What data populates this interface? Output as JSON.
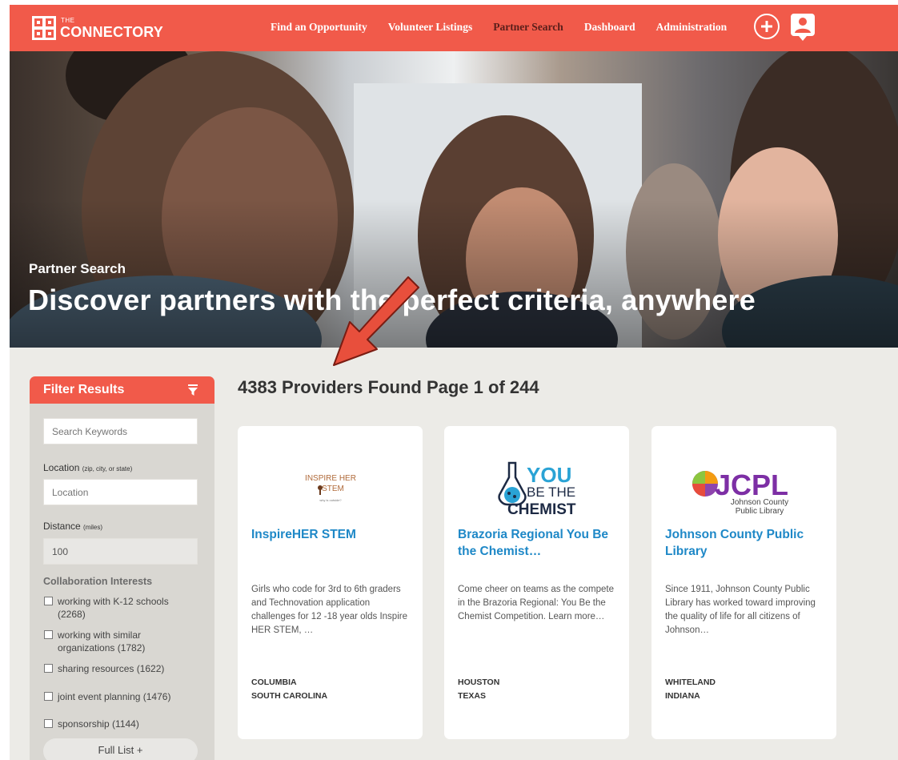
{
  "brand": {
    "small": "THE",
    "name": "CONNECTORY",
    "color": "#f15a4a"
  },
  "nav": {
    "items": [
      {
        "label": "Find an Opportunity",
        "active": false
      },
      {
        "label": "Volunteer Listings",
        "active": false
      },
      {
        "label": "Partner Search",
        "active": true
      },
      {
        "label": "Dashboard",
        "active": false
      },
      {
        "label": "Administration",
        "active": false
      }
    ],
    "add_icon": "plus-circle-icon",
    "user_icon": "user-profile-icon"
  },
  "hero": {
    "subtitle": "Partner Search",
    "title": "Discover partners with the perfect criteria, anywhere"
  },
  "filter": {
    "title": "Filter Results",
    "filter_icon": "funnel-icon",
    "search_placeholder": "Search Keywords",
    "location_label": "Location",
    "location_hint": "(zip, city, or state)",
    "location_placeholder": "Location",
    "distance_label": "Distance",
    "distance_hint": "(miles)",
    "distance_value": "100",
    "collab_title": "Collaboration Interests",
    "options": [
      {
        "line1": "working with K-12 schools",
        "line2": "(2268)"
      },
      {
        "line1": "working with similar",
        "line2": "organizations (1782)"
      },
      {
        "line1": "sharing resources (1622)",
        "line2": ""
      },
      {
        "line1": "joint event planning (1476)",
        "line2": ""
      },
      {
        "line1": "sponsorship (1144)",
        "line2": ""
      }
    ],
    "full_list": "Full List +"
  },
  "results": {
    "heading": "4383 Providers Found Page 1 of 244",
    "cards": [
      {
        "logo_text": "INSPIRE HER STEM",
        "name": "InspireHER STEM",
        "description": "Girls who code for 3rd to 6th graders and Technovation application challenges for 12 -18 year olds Inspire  HER STEM, …",
        "city": "COLUMBIA",
        "state": "SOUTH CAROLINA"
      },
      {
        "logo_text": "YOU BE THE CHEMIST",
        "name": "Brazoria Regional You Be the Chemist…",
        "description": "Come cheer on teams as the compete in the Brazoria Regional: You Be the Chemist Competition. Learn more…",
        "city": "HOUSTON",
        "state": "TEXAS"
      },
      {
        "logo_text": "JCPL",
        "logo_sub": "Johnson County Public Library",
        "name": "Johnson County Public Library",
        "description": "Since  1911, Johnson County Public Library has worked toward improving the quality of life for all citizens of Johnson…",
        "city": "WHITELAND",
        "state": "INDIANA"
      }
    ]
  },
  "colors": {
    "accent": "#f15a4a",
    "link": "#1e88c7",
    "background": "#ecebe7"
  }
}
